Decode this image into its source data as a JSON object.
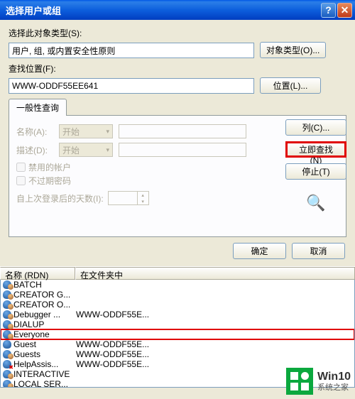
{
  "titlebar": {
    "title": "选择用户或组"
  },
  "section1": {
    "label": "选择此对象类型(S):",
    "value": "用户, 组, 或内置安全性原则",
    "button": "对象类型(O)..."
  },
  "section2": {
    "label": "查找位置(F):",
    "value": "WWW-ODDF55EE641",
    "button": "位置(L)..."
  },
  "tab": {
    "label": "一般性查询"
  },
  "form": {
    "name_label": "名称(A):",
    "name_op": "开始",
    "desc_label": "描述(D):",
    "desc_op": "开始",
    "cb_disabled": "禁用的帐户",
    "cb_noexpire": "不过期密码",
    "days_label": "自上次登录后的天数(I):"
  },
  "sidebuttons": {
    "columns": "列(C)...",
    "findnow": "立即查找(N)",
    "stop": "停止(T)"
  },
  "okcancel": {
    "ok": "确定",
    "cancel": "取消"
  },
  "list": {
    "col1": "名称 (RDN)",
    "col2": "在文件夹中",
    "rows": [
      {
        "name": "BATCH",
        "folder": "",
        "icon": "multi"
      },
      {
        "name": "CREATOR G...",
        "folder": "",
        "icon": "multi"
      },
      {
        "name": "CREATOR O...",
        "folder": "",
        "icon": "multi"
      },
      {
        "name": "Debugger ...",
        "folder": "WWW-ODDF55E...",
        "icon": "multi"
      },
      {
        "name": "DIALUP",
        "folder": "",
        "icon": "multi"
      },
      {
        "name": "Everyone",
        "folder": "",
        "icon": "multi",
        "highlight": true
      },
      {
        "name": "Guest",
        "folder": "WWW-ODDF55E...",
        "icon": "single"
      },
      {
        "name": "Guests",
        "folder": "WWW-ODDF55E...",
        "icon": "multi"
      },
      {
        "name": "HelpAssis...",
        "folder": "WWW-ODDF55E...",
        "icon": "err"
      },
      {
        "name": "INTERACTIVE",
        "folder": "",
        "icon": "multi"
      },
      {
        "name": "LOCAL SER...",
        "folder": "",
        "icon": "multi"
      }
    ]
  },
  "watermark": {
    "big": "Win10",
    "small": "系统之家"
  }
}
